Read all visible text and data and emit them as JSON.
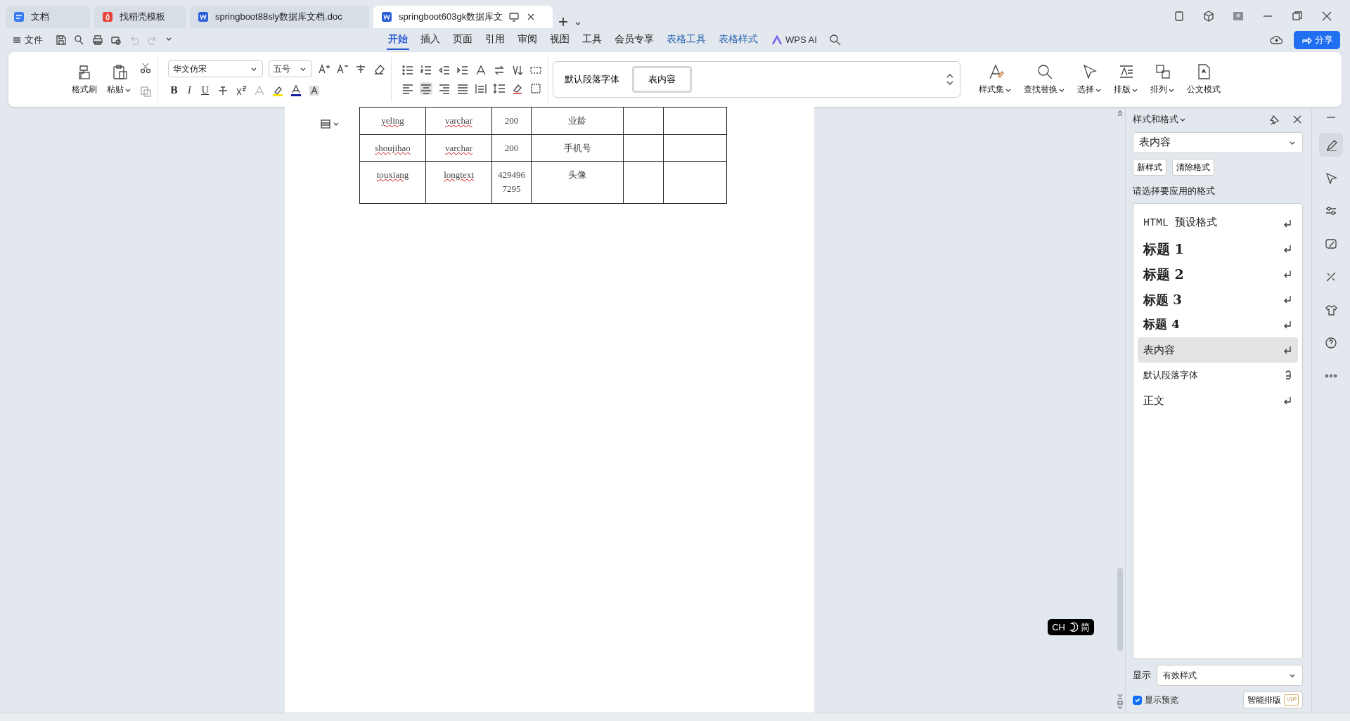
{
  "tabs": [
    {
      "label": "文档",
      "kind": "docs",
      "selected": false
    },
    {
      "label": "找稻壳模板",
      "kind": "template",
      "selected": false
    },
    {
      "label": "springboot88sly数据库文档.doc",
      "kind": "word",
      "selected": false
    },
    {
      "label": "springboot603gk数据库文",
      "kind": "word",
      "selected": true
    }
  ],
  "file_menu": "文件",
  "ribbon_tabs": [
    {
      "label": "开始",
      "kind": "main",
      "selected": true
    },
    {
      "label": "插入",
      "kind": "main",
      "selected": false
    },
    {
      "label": "页面",
      "kind": "main",
      "selected": false
    },
    {
      "label": "引用",
      "kind": "main",
      "selected": false
    },
    {
      "label": "审阅",
      "kind": "main",
      "selected": false
    },
    {
      "label": "视图",
      "kind": "main",
      "selected": false
    },
    {
      "label": "工具",
      "kind": "main",
      "selected": false
    },
    {
      "label": "会员专享",
      "kind": "main",
      "selected": false
    },
    {
      "label": "表格工具",
      "kind": "context",
      "selected": false
    },
    {
      "label": "表格样式",
      "kind": "context",
      "selected": false
    }
  ],
  "ai_button": "WPS AI",
  "share_button": "分享",
  "ribbon": {
    "clipboard": [
      "格式刷",
      "粘贴"
    ],
    "font_name": "华文仿宋",
    "font_size": "五号",
    "format_keys": [
      "B",
      "I",
      "U"
    ],
    "style_gallery": [
      {
        "label": "默认段落字体",
        "selected": false
      },
      {
        "label": "表内容",
        "selected": true
      }
    ],
    "right_buttons": [
      {
        "label": "样式集",
        "kind": "styles"
      },
      {
        "label": "查找替换",
        "kind": "find"
      },
      {
        "label": "选择",
        "kind": "select"
      },
      {
        "label": "排版",
        "kind": "layout"
      },
      {
        "label": "排列",
        "kind": "arrange"
      },
      {
        "label": "公文模式",
        "kind": "official"
      }
    ]
  },
  "table": {
    "rows": [
      {
        "cells": [
          {
            "text": "yeling",
            "misspelled": true
          },
          {
            "text": "varchar",
            "misspelled": true
          },
          {
            "text": "200",
            "misspelled": false
          },
          {
            "text": "业龄",
            "misspelled": false
          }
        ]
      },
      {
        "cells": [
          {
            "text": "shoujihao",
            "misspelled": true
          },
          {
            "text": "varchar",
            "misspelled": true
          },
          {
            "text": "200",
            "misspelled": false
          },
          {
            "text": "手机号",
            "misspelled": false
          }
        ]
      },
      {
        "cells": [
          {
            "text": "touxiang",
            "misspelled": true
          },
          {
            "text": "longtext",
            "misspelled": true
          },
          {
            "text": "4294967295",
            "misspelled": false
          },
          {
            "text": "头像",
            "misspelled": false
          }
        ]
      }
    ]
  },
  "styles_panel": {
    "title": "样式和格式",
    "current_style": "表内容",
    "buttons": [
      "新样式",
      "清除格式"
    ],
    "prompt": "请选择要应用的格式",
    "styles": [
      {
        "label": "HTML 预设格式",
        "kind": "html",
        "selected": false
      },
      {
        "label": "标题 1",
        "kind": "h1",
        "selected": false
      },
      {
        "label": "标题 2",
        "kind": "h2",
        "selected": false
      },
      {
        "label": "标题 3",
        "kind": "h3",
        "selected": false
      },
      {
        "label": "标题 4",
        "kind": "h4",
        "selected": false
      },
      {
        "label": "表内容",
        "kind": "normal",
        "selected": true
      },
      {
        "label": "默认段落字体",
        "kind": "char",
        "selected": false
      },
      {
        "label": "正文",
        "kind": "normal",
        "selected": false
      }
    ],
    "show_label": "显示",
    "show_value": "有效样式",
    "preview": {
      "label": "显示预览",
      "checked": true
    },
    "smart_button": "智能排版",
    "vip_badge": "VIP"
  },
  "ime": {
    "lang": "CH",
    "mode": "简"
  }
}
